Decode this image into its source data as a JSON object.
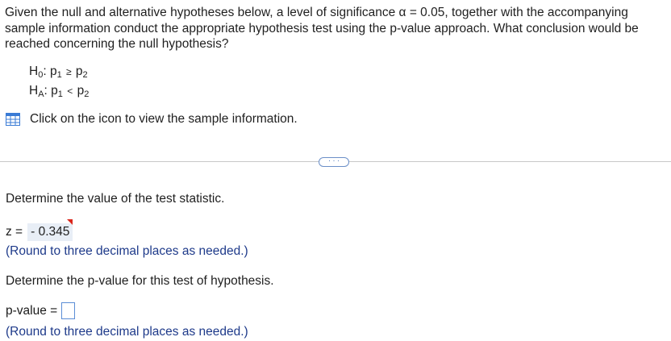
{
  "question": {
    "text": "Given the null and alternative hypotheses below, a level of significance α = 0.05, together with the accompanying sample information conduct the appropriate hypothesis test using the p-value approach. What conclusion would be reached concerning the null hypothesis?"
  },
  "hypotheses": [
    {
      "label": "H",
      "label_sub": "0",
      "left": "p",
      "left_sub": "1",
      "relation": "≥",
      "right": "p",
      "right_sub": "2"
    },
    {
      "label": "H",
      "label_sub": "A",
      "left": "p",
      "left_sub": "1",
      "relation": "<",
      "right": "p",
      "right_sub": "2"
    }
  ],
  "info": {
    "text": "Click on the icon to view the sample information.",
    "icon": "table-icon"
  },
  "more_button": {
    "label": "· · ·"
  },
  "steps": {
    "step1_prompt": "Determine the value of the test statistic.",
    "z_label": "z =",
    "z_value": "- 0.345",
    "hint1": "(Round to three decimal places as needed.)",
    "step2_prompt": "Determine the p-value for this test of hypothesis.",
    "p_label": "p-value =",
    "p_value": "",
    "hint2": "(Round to three decimal places as needed.)"
  },
  "colors": {
    "hint": "#1e3a8a",
    "answer_bg": "#e8eef6",
    "flag": "#d9261c",
    "input_border": "#5b8dd6"
  }
}
